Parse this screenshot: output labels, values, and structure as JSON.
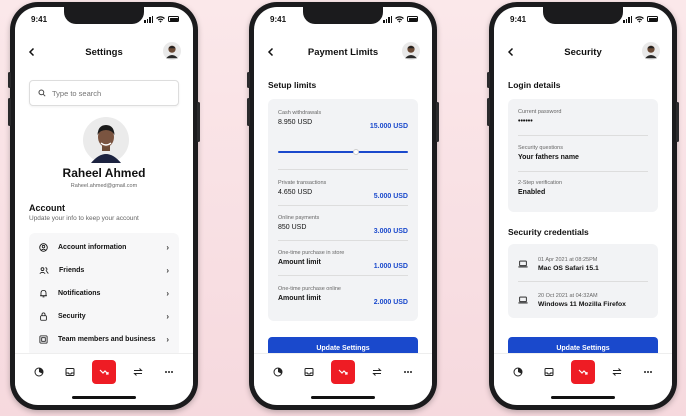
{
  "status_time": "9:41",
  "colors": {
    "accent": "#1a49cc",
    "active_tab": "#ee1c24",
    "background": "#fbe8ea"
  },
  "tabbar": {
    "icons": [
      "pie-chart-icon",
      "inbox-icon",
      "chart-trend-icon",
      "transfer-icon",
      "more-icon"
    ]
  },
  "settings": {
    "title": "Settings",
    "search_placeholder": "Type to search",
    "profile_name": "Raheel Ahmed",
    "profile_email": "Raheel.ahmed@gmail.com",
    "account_heading": "Account",
    "account_subtitle": "Update your info to keep your account",
    "menu": [
      {
        "label": "Account information",
        "icon": "user-circle-icon"
      },
      {
        "label": "Friends",
        "icon": "users-icon"
      },
      {
        "label": "Notifications",
        "icon": "bell-icon"
      },
      {
        "label": "Security",
        "icon": "lock-icon"
      },
      {
        "label": "Team members and business",
        "icon": "id-card-icon"
      }
    ]
  },
  "payment": {
    "title": "Payment Limits",
    "section": "Setup limits",
    "cash": {
      "label": "Cash withdrawals",
      "value": "8.950 USD",
      "limit": "15.000 USD",
      "slider_fraction": 0.6
    },
    "items": [
      {
        "label": "Private transactions",
        "value": "4.650 USD",
        "limit": "5.000 USD"
      },
      {
        "label": "Online payments",
        "value": "850 USD",
        "limit": "3.000 USD"
      },
      {
        "label": "One-time purchase in store",
        "value": "Amount limit",
        "limit": "1.000 USD"
      },
      {
        "label": "One-time purchase online",
        "value": "Amount limit",
        "limit": "2.000 USD"
      }
    ],
    "button": "Update Settings"
  },
  "security": {
    "title": "Security",
    "login_heading": "Login details",
    "login_rows": [
      {
        "label": "Current password",
        "value": "••••••"
      },
      {
        "label": "Security questions",
        "value": "Your fathers name"
      },
      {
        "label": "2-Step verification",
        "value": "Enabled"
      }
    ],
    "credentials_heading": "Security credentials",
    "devices": [
      {
        "date": "01 Apr 2021 at 08:25PM",
        "name": "Mac OS Safari 15.1"
      },
      {
        "date": "20 Oct 2021 at 04:32AM",
        "name": "Windows 11 Mozilla Firefox"
      }
    ],
    "button": "Update Settings"
  }
}
